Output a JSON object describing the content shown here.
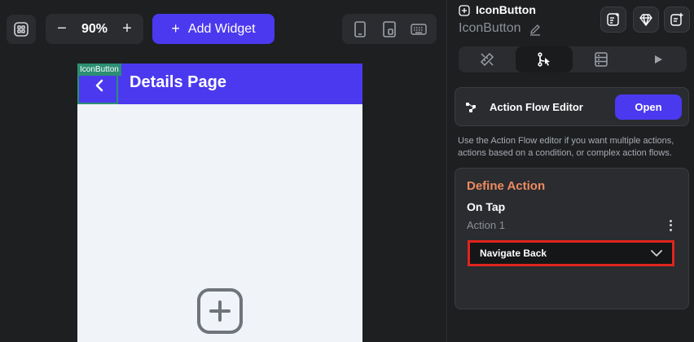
{
  "toolbar": {
    "zoom_value": "90%",
    "zoom_out": "−",
    "zoom_in": "+",
    "add_widget_plus": "+",
    "add_widget_label": "Add Widget"
  },
  "canvas": {
    "selection_tag": "IconButton",
    "page_title": "Details Page"
  },
  "panel": {
    "widget_type": "IconButton",
    "widget_name": "IconButton",
    "action_flow_title": "Action Flow Editor",
    "open_label": "Open",
    "description": "Use the Action Flow editor if you want multiple actions, actions based on a condition, or complex action flows.",
    "define_action_title": "Define Action",
    "trigger": "On Tap",
    "action_label": "Action 1",
    "action_value": "Navigate Back"
  },
  "colors": {
    "accent": "#4b39ef",
    "define_title": "#ee8b60",
    "highlight": "#e0241b",
    "selection": "#2c8f73"
  }
}
